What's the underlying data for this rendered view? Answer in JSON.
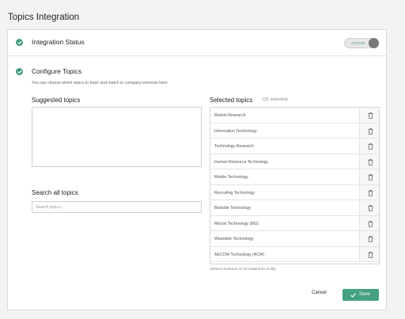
{
  "page": {
    "title": "Topics Integration"
  },
  "status": {
    "label": "Integration Status",
    "toggle_text": "ACTIVE"
  },
  "config": {
    "title": "Configure Topics",
    "description": "You can choose which topics to track and match to company interests here"
  },
  "suggested": {
    "title": "Suggested topics"
  },
  "search": {
    "title": "Search all topics",
    "placeholder": "Search topics...",
    "value": ""
  },
  "selected": {
    "title": "Selected topics",
    "count_text": "(22 selected)",
    "items": [
      {
        "label": "Market Research"
      },
      {
        "label": "Information Technology"
      },
      {
        "label": "Technology Research"
      },
      {
        "label": "Human Resource Technology"
      },
      {
        "label": "Mobile Technology"
      },
      {
        "label": "Recruiting Technology"
      },
      {
        "label": "Bedside Technology"
      },
      {
        "label": "Micron Technology (MU)"
      },
      {
        "label": "Wearable Technology"
      },
      {
        "label": "AECOM Technology (ACM)"
      }
    ],
    "hint": "(Select minimum of 10 maximum of 25)"
  },
  "actions": {
    "cancel_label": "Cancel",
    "save_label": "Save"
  },
  "colors": {
    "accent": "#45a17f",
    "check": "#3f9a7c"
  },
  "icons": {
    "status": "check-circle-icon",
    "delete": "trash-icon",
    "save": "checkmark-icon"
  }
}
